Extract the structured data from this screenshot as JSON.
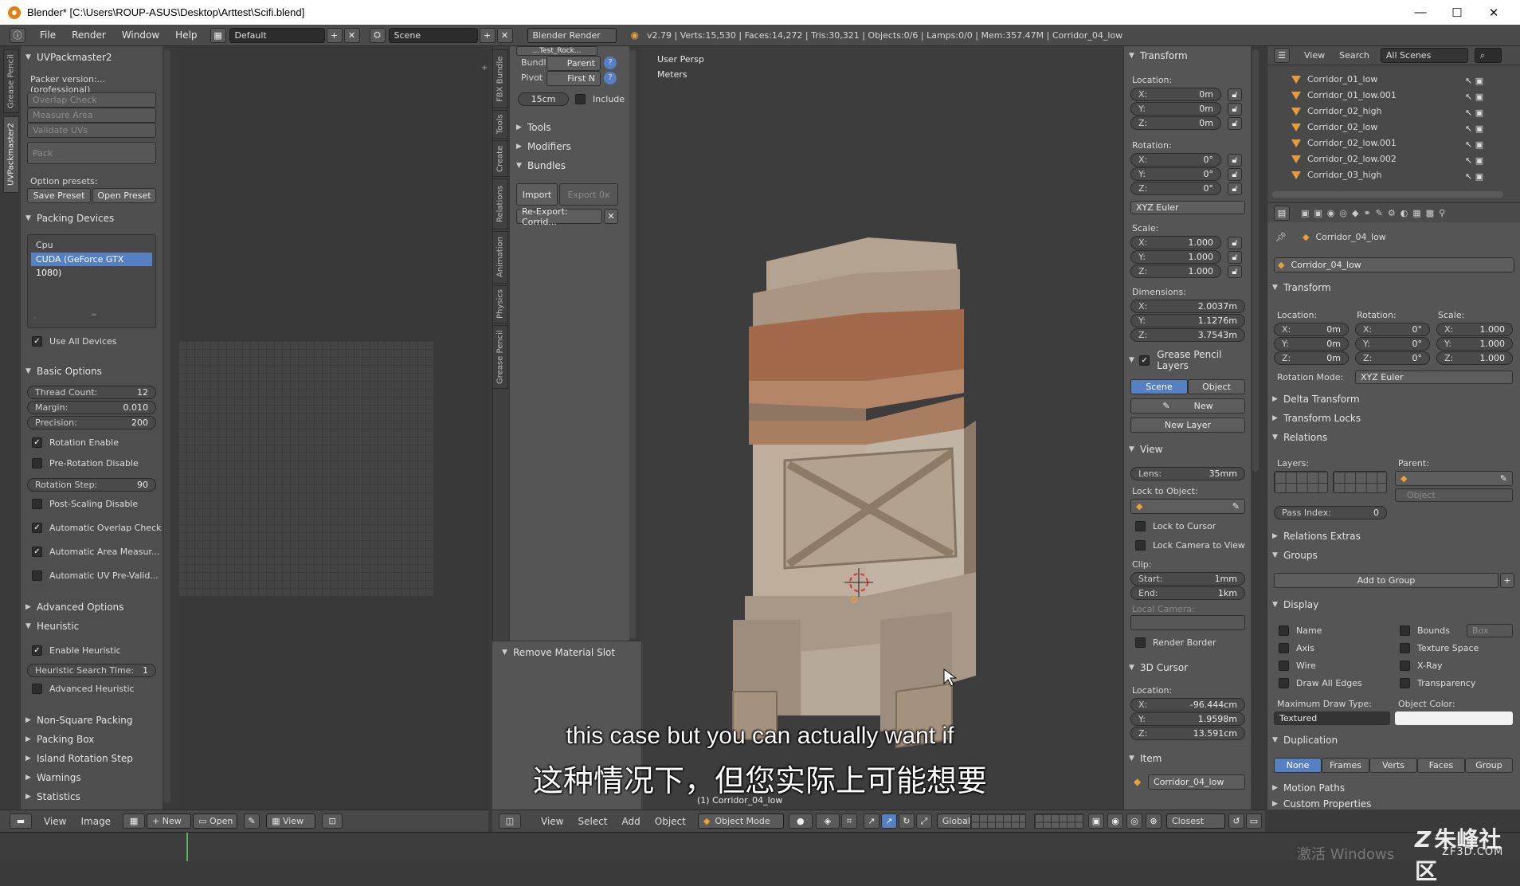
{
  "window": {
    "title": "Blender* [C:\\Users\\ROUP-ASUS\\Desktop\\Arttest\\Scifi.blend]",
    "minimize": "—",
    "maximize": "☐",
    "close": "✕"
  },
  "menubar": {
    "items": [
      "File",
      "Render",
      "Window",
      "Help"
    ],
    "layout": "Default",
    "scene": "Scene",
    "render_engine": "Blender Render",
    "stats": "v2.79 | Verts:15,530 | Faces:14,272 | Tris:30,321 | Objects:0/6 | Lamps:0/0 | Mem:357.47M | Corridor_04_low"
  },
  "left_tabs": [
    "Grease Pencil",
    "UVPackmaster2"
  ],
  "uvpack": {
    "title": "UVPackmaster2",
    "version": "Packer version:... (professional)",
    "overlap_check": "Overlap Check",
    "measure_area": "Measure Area",
    "validate_uvs": "Validate UVs",
    "pack": "Pack",
    "option_presets": "Option presets:",
    "save_preset": "Save Preset",
    "open_preset": "Open Preset",
    "packing_devices": "Packing Devices",
    "devices": [
      "Cpu",
      "CUDA (GeForce GTX 1080)"
    ],
    "use_all_devices": "Use All Devices",
    "basic_options": "Basic Options",
    "thread_count_label": "Thread Count:",
    "thread_count": "12",
    "margin_label": "Margin:",
    "margin": "0.010",
    "precision_label": "Precision:",
    "precision": "200",
    "rotation_enable": "Rotation Enable",
    "pre_rotation_disable": "Pre-Rotation Disable",
    "rotation_step_label": "Rotation Step:",
    "rotation_step": "90",
    "post_scaling_disable": "Post-Scaling Disable",
    "auto_overlap_check": "Automatic Overlap Check",
    "auto_area_measure": "Automatic Area Measur...",
    "auto_uv_prevalid": "Automatic UV Pre-Valid...",
    "advanced_options": "Advanced Options",
    "heuristic": "Heuristic",
    "enable_heuristic": "Enable Heuristic",
    "heuristic_time_label": "Heuristic Search Time:",
    "heuristic_time": "1",
    "advanced_heuristic": "Advanced Heuristic",
    "collapsed": [
      "Non-Square Packing",
      "Packing Box",
      "Island Rotation Step",
      "Warnings",
      "Statistics"
    ]
  },
  "uv_header": {
    "items": [
      "View",
      "Image"
    ],
    "new": "New",
    "open": "Open",
    "view": "View"
  },
  "toolshelf": {
    "tabs": [
      "FBX Bundle",
      "Tools",
      "Create",
      "Relations",
      "Animation",
      "Physics",
      "Grease Pencil"
    ],
    "top_field": "...Test_Rock...",
    "bundle_label": "Bundl",
    "parent": "Parent",
    "pivot_label": "Pivot",
    "first_n": "First N",
    "size": "15cm",
    "include": "Include",
    "tools": "Tools",
    "modifiers": "Modifiers",
    "bundles": "Bundles",
    "import": "Import",
    "export": "Export 0x",
    "reexport": "Re-Export: Corrid...",
    "remove_material_slot": "Remove Material Slot"
  },
  "viewport": {
    "persp": "User Persp",
    "units": "Meters",
    "object_label": "(1) Corridor_04_low"
  },
  "viewport_header": {
    "items": [
      "View",
      "Select",
      "Add",
      "Object"
    ],
    "mode": "Object Mode",
    "orientation": "Global",
    "snap": "Closest"
  },
  "npanel": {
    "transform": "Transform",
    "location": "Location:",
    "loc": [
      [
        "X:",
        "0m"
      ],
      [
        "Y:",
        "0m"
      ],
      [
        "Z:",
        "0m"
      ]
    ],
    "rotation": "Rotation:",
    "rot": [
      [
        "X:",
        "0°"
      ],
      [
        "Y:",
        "0°"
      ],
      [
        "Z:",
        "0°"
      ]
    ],
    "rot_mode": "XYZ Euler",
    "scale": "Scale:",
    "scl": [
      [
        "X:",
        "1.000"
      ],
      [
        "Y:",
        "1.000"
      ],
      [
        "Z:",
        "1.000"
      ]
    ],
    "dimensions": "Dimensions:",
    "dim": [
      [
        "X:",
        "2.0037m"
      ],
      [
        "Y:",
        "1.1276m"
      ],
      [
        "Z:",
        "3.7543m"
      ]
    ],
    "gp_layers": "Grease Pencil Layers",
    "gp_scene": "Scene",
    "gp_object": "Object",
    "gp_new": "New",
    "gp_new_layer": "New Layer",
    "view": "View",
    "lens_label": "Lens:",
    "lens": "35mm",
    "lock_to_object": "Lock to Object:",
    "lock_to_cursor": "Lock to Cursor",
    "lock_camera": "Lock Camera to View",
    "clip": "Clip:",
    "clip_start_label": "Start:",
    "clip_start": "1mm",
    "clip_end_label": "End:",
    "clip_end": "1km",
    "local_camera": "Local Camera:",
    "render_border": "Render Border",
    "cursor": "3D Cursor",
    "cursor_location": "Location:",
    "cur": [
      [
        "X:",
        "-96.444cm"
      ],
      [
        "Y:",
        "1.9598m"
      ],
      [
        "Z:",
        "13.591cm"
      ]
    ],
    "item": "Item",
    "item_name": "Corridor_04_low"
  },
  "outliner": {
    "view": "View",
    "search": "Search",
    "scenes": "All Scenes",
    "rows": [
      "Corridor_01_low",
      "Corridor_01_low.001",
      "Corridor_02_high",
      "Corridor_02_low",
      "Corridor_02_low.001",
      "Corridor_02_low.002",
      "Corridor_03_high"
    ]
  },
  "properties": {
    "breadcrumb": "Corridor_04_low",
    "object_name": "Corridor_04_low",
    "transform": "Transform",
    "location": "Location:",
    "rotation": "Rotation:",
    "scale": "Scale:",
    "loc": [
      [
        "X:",
        "0m"
      ],
      [
        "Y:",
        "0m"
      ],
      [
        "Z:",
        "0m"
      ]
    ],
    "rot": [
      [
        "X:",
        "0°"
      ],
      [
        "Y:",
        "0°"
      ],
      [
        "Z:",
        "0°"
      ]
    ],
    "scl": [
      [
        "X:",
        "1.000"
      ],
      [
        "Y:",
        "1.000"
      ],
      [
        "Z:",
        "1.000"
      ]
    ],
    "rotation_mode_label": "Rotation Mode:",
    "rotation_mode": "XYZ Euler",
    "delta_transform": "Delta Transform",
    "transform_locks": "Transform Locks",
    "relations": "Relations",
    "layers": "Layers:",
    "parent": "Parent:",
    "parent_type": "Object",
    "pass_index_label": "Pass Index:",
    "pass_index": "0",
    "relations_extras": "Relations Extras",
    "groups": "Groups",
    "add_to_group": "Add to Group",
    "display": "Display",
    "name": "Name",
    "axis": "Axis",
    "wire": "Wire",
    "draw_all_edges": "Draw All Edges",
    "bounds": "Bounds",
    "bounds_type": "Box",
    "texture_space": "Texture Space",
    "xray": "X-Ray",
    "transparency": "Transparency",
    "max_draw_type": "Maximum Draw Type:",
    "object_color": "Object Color:",
    "draw_type": "Textured",
    "duplication": "Duplication",
    "dup_options": [
      "None",
      "Frames",
      "Verts",
      "Faces",
      "Group"
    ],
    "motion_paths": "Motion Paths",
    "custom_properties": "Custom Properties"
  },
  "subtitles": {
    "en": "this case but you can actually want if",
    "zh": "这种情况下，但您实际上可能想要"
  },
  "watermark": {
    "brand": "朱峰社区",
    "site": "ZF3D.COM",
    "windows": "激活 Windows"
  },
  "colors": {
    "accent": "#5680c2",
    "blender_orange": "#e87d0d"
  }
}
